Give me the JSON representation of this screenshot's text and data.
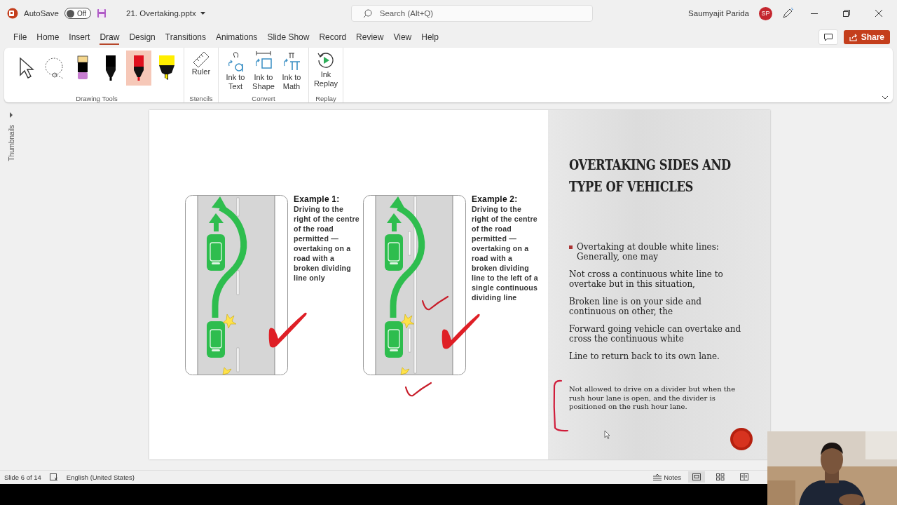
{
  "title_bar": {
    "autosave_label": "AutoSave",
    "autosave_toggle": {
      "label": "Off",
      "on": false
    },
    "file_name": "21. Overtaking.pptx",
    "search": {
      "placeholder": "Search (Alt+Q)"
    },
    "user_name": "Saumyajit Parida",
    "avatar": "SP"
  },
  "menu_tabs": [
    {
      "label": "File",
      "selected": false
    },
    {
      "label": "Home",
      "selected": false
    },
    {
      "label": "Insert",
      "selected": false
    },
    {
      "label": "Draw",
      "selected": true
    },
    {
      "label": "Design",
      "selected": false
    },
    {
      "label": "Transitions",
      "selected": false
    },
    {
      "label": "Animations",
      "selected": false
    },
    {
      "label": "Slide Show",
      "selected": false
    },
    {
      "label": "Record",
      "selected": false
    },
    {
      "label": "Review",
      "selected": false
    },
    {
      "label": "View",
      "selected": false
    },
    {
      "label": "Help",
      "selected": false
    }
  ],
  "share_button": "Share",
  "ribbon": {
    "drawing_tools": {
      "label": "Drawing Tools",
      "tools": [
        {
          "kind": "select",
          "selected": false
        },
        {
          "kind": "lasso",
          "selected": false
        },
        {
          "kind": "pencil",
          "selected": false,
          "color": "#c77dd1"
        },
        {
          "kind": "pen",
          "selected": false,
          "color": "#000000"
        },
        {
          "kind": "pen",
          "selected": true,
          "color": "#e0101e"
        },
        {
          "kind": "highlighter",
          "selected": false,
          "color": "#ffee00"
        }
      ]
    },
    "stencils": {
      "label": "Stencils",
      "buttons": [
        {
          "kind": "ruler",
          "label": "Ruler"
        }
      ]
    },
    "convert": {
      "label": "Convert",
      "buttons": [
        {
          "kind": "ink-text",
          "label": "Ink to Text"
        },
        {
          "kind": "ink-shape",
          "label": "Ink to Shape"
        },
        {
          "kind": "ink-math",
          "label": "Ink to Math"
        }
      ]
    },
    "replay": {
      "label": "Replay",
      "buttons": [
        {
          "kind": "replay",
          "label": "Ink Replay"
        }
      ]
    }
  },
  "sidebar": {
    "label": "Thumbnails"
  },
  "slide": {
    "examples": [
      {
        "title": "Example 1:",
        "text": "Driving to the right of the centre of the road permitted — overtaking on a road with a broken dividing line only",
        "kind": "broken"
      },
      {
        "title": "Example 2:",
        "text": "Driving to the right of the centre of the road permitted — overtaking on a road with a broken dividing line to the left of a single continuous dividing line",
        "kind": "broken-continuous"
      }
    ],
    "title": "OVERTAKING SIDES AND TYPE OF VEHICLES",
    "paragraphs": [
      {
        "text": "Overtaking at double white lines: Generally, one may",
        "bulleted": true
      },
      {
        "text": "Not cross a continuous white line to overtake but in this situation,",
        "bulleted": false
      },
      {
        "text": "Broken line is on your side and continuous on other, the",
        "bulleted": false
      },
      {
        "text": "Forward going vehicle can overtake and cross the continuous white",
        "bulleted": false
      },
      {
        "text": "Line to return back to its own lane.",
        "bulleted": false
      }
    ],
    "note": "Not allowed to drive on a divider but when the rush hour lane is open, and the divider is positioned on the rush hour lane."
  },
  "status_bar": {
    "slide_counter": "Slide 6 of 14",
    "language": "English (United States)",
    "notes": "Notes",
    "views": [
      {
        "kind": "normal",
        "selected": true
      },
      {
        "kind": "sorter",
        "selected": false
      },
      {
        "kind": "reading",
        "selected": false
      }
    ]
  }
}
